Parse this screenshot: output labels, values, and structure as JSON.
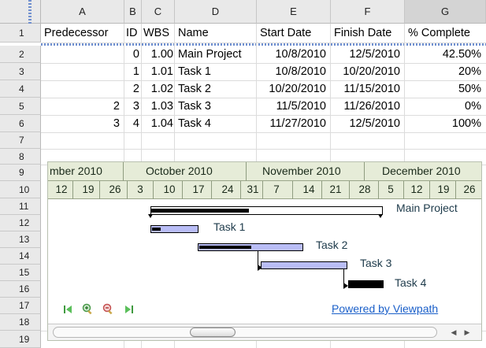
{
  "columns": [
    "A",
    "B",
    "C",
    "D",
    "E",
    "F",
    "G"
  ],
  "selected_column": "G",
  "row_numbers": [
    "1",
    "2",
    "3",
    "4",
    "5",
    "6",
    "7",
    "8",
    "9",
    "10",
    "11",
    "12",
    "13",
    "14",
    "15",
    "16",
    "17",
    "18",
    "19"
  ],
  "headers": {
    "predecessor": "Predecessor",
    "id": "ID",
    "wbs": "WBS",
    "name": "Name",
    "start": "Start Date",
    "finish": "Finish Date",
    "complete": "% Complete"
  },
  "rows": [
    {
      "predecessor": "",
      "id": "0",
      "wbs": "1.00",
      "name": "Main Project",
      "start": "10/8/2010",
      "finish": "12/5/2010",
      "complete": "42.50%"
    },
    {
      "predecessor": "",
      "id": "1",
      "wbs": "1.01",
      "name": "Task 1",
      "start": "10/8/2010",
      "finish": "10/20/2010",
      "complete": "20%"
    },
    {
      "predecessor": "",
      "id": "2",
      "wbs": "1.02",
      "name": "Task 2",
      "start": "10/20/2010",
      "finish": "11/15/2010",
      "complete": "50%"
    },
    {
      "predecessor": "2",
      "id": "3",
      "wbs": "1.03",
      "name": "Task 3",
      "start": "11/5/2010",
      "finish": "11/26/2010",
      "complete": "0%"
    },
    {
      "predecessor": "3",
      "id": "4",
      "wbs": "1.04",
      "name": "Task 4",
      "start": "11/27/2010",
      "finish": "12/5/2010",
      "complete": "100%"
    }
  ],
  "gantt": {
    "months": [
      "mber 2010",
      "October 2010",
      "November 2010",
      "December 2010"
    ],
    "weeks": [
      "12",
      "19",
      "26",
      "3",
      "10",
      "17",
      "24",
      "31",
      "7",
      "14",
      "21",
      "28",
      "5",
      "12",
      "19",
      "26"
    ],
    "task_labels": [
      "Main Project",
      "Task 1",
      "Task 2",
      "Task 3",
      "Task 4"
    ],
    "bar_fill_color": "#b9bdf6",
    "progress_color": "#000000",
    "timeline_color": "#e6ecd8",
    "nav_icons": [
      "first-page-icon",
      "zoom-in-icon",
      "zoom-out-icon",
      "last-page-icon"
    ],
    "powered_by": "Powered by Viewpath"
  }
}
